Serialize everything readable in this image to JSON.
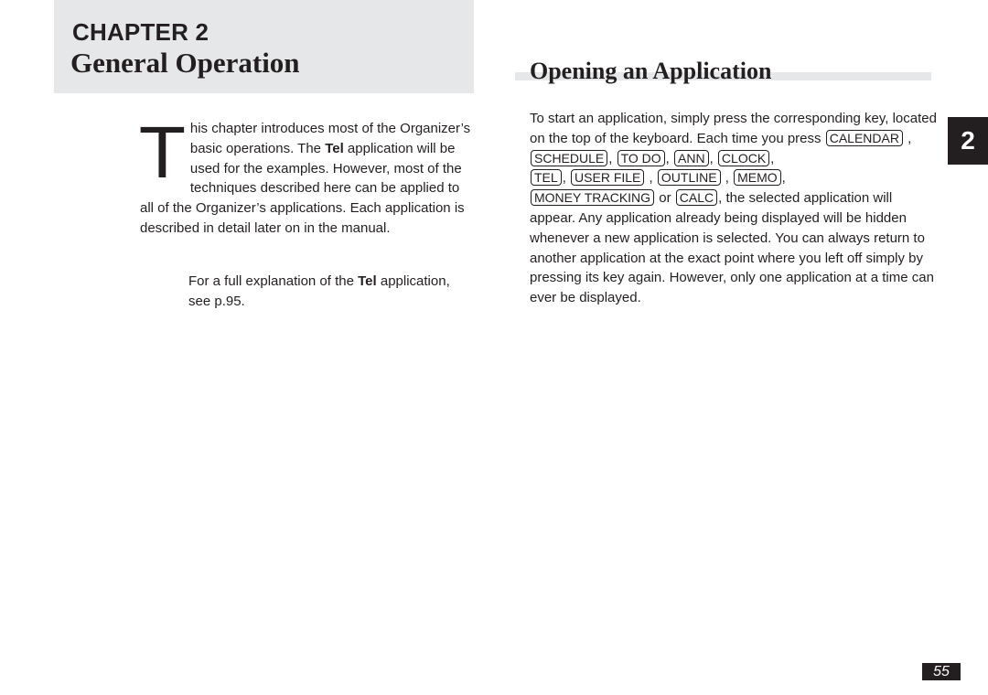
{
  "chapter": {
    "label": "CHAPTER 2",
    "title": "General Operation"
  },
  "intro": {
    "dropcap": "T",
    "line1": "his chapter introduces most of the Organizer’s basic operations. The ",
    "bold1": "Tel",
    "line2": " application will be used for the examples. However, most of the techniques described here can be applied to all of the Organizer’s applications. Each application is described in detail later on in the manual."
  },
  "note": {
    "prefix": "For a full explanation of the ",
    "bold": "Tel",
    "suffix": " application, see p.95."
  },
  "section": {
    "title": "Opening an Application",
    "text_before": "To start an application, simply press the corresponding key, located on the top of the keyboard. Each time you press ",
    "keys": [
      "CALENDAR",
      "SCHEDULE",
      "TO DO",
      "ANN",
      "CLOCK",
      "TEL",
      "USER FILE",
      "OUTLINE",
      "MEMO",
      "MONEY TRACKING",
      "CALC"
    ],
    "or_word": "or",
    "text_after": ", the selected application will appear. Any application already being displayed will be hidden whenever a new application is selected. You can always return to another application at the exact point where you left off simply by pressing its key again. However, only one application at a time can ever be displayed."
  },
  "chapter_tab": "2",
  "page_number": "55"
}
